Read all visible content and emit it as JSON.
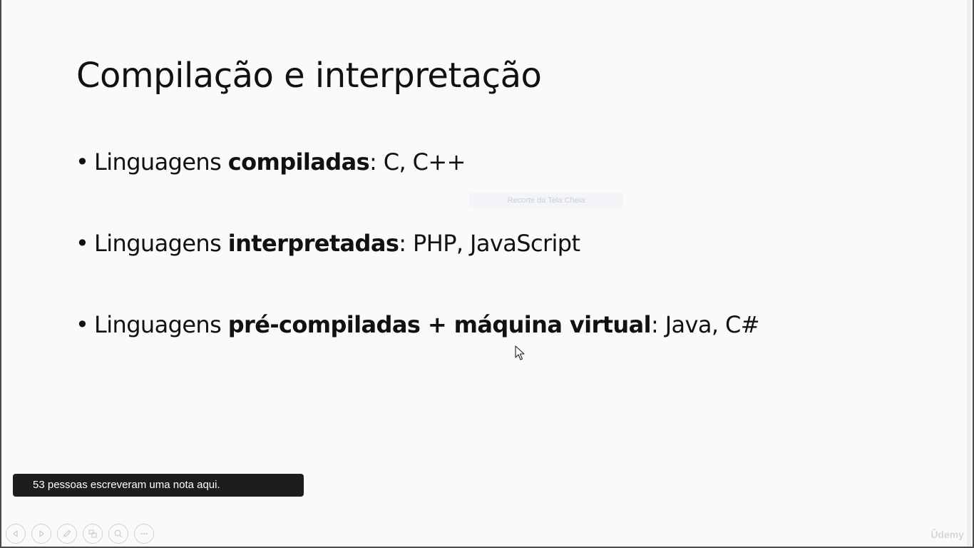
{
  "slide": {
    "title": "Compilação e interpretação",
    "bullets": [
      {
        "prefix": "Linguagens ",
        "bold": "compiladas",
        "suffix": ": C, C++"
      },
      {
        "prefix": "Linguagens ",
        "bold": "interpretadas",
        "suffix": ": PHP, JavaScript"
      },
      {
        "prefix": "Linguagens ",
        "bold": "pré-compiladas + máquina virtual",
        "suffix": ": Java, C#"
      }
    ],
    "bullet_char": "•"
  },
  "overlay": {
    "watermark_text": "Recorte da Tela Cheia"
  },
  "note_toast": {
    "text": "53 pessoas escreveram uma nota aqui."
  },
  "toolbar": {
    "buttons": [
      "previous-slide-icon",
      "next-slide-icon",
      "pen-icon",
      "slides-grid-icon",
      "zoom-icon",
      "more-options-icon"
    ]
  },
  "brand": {
    "logo_text": "Ûdemy"
  }
}
